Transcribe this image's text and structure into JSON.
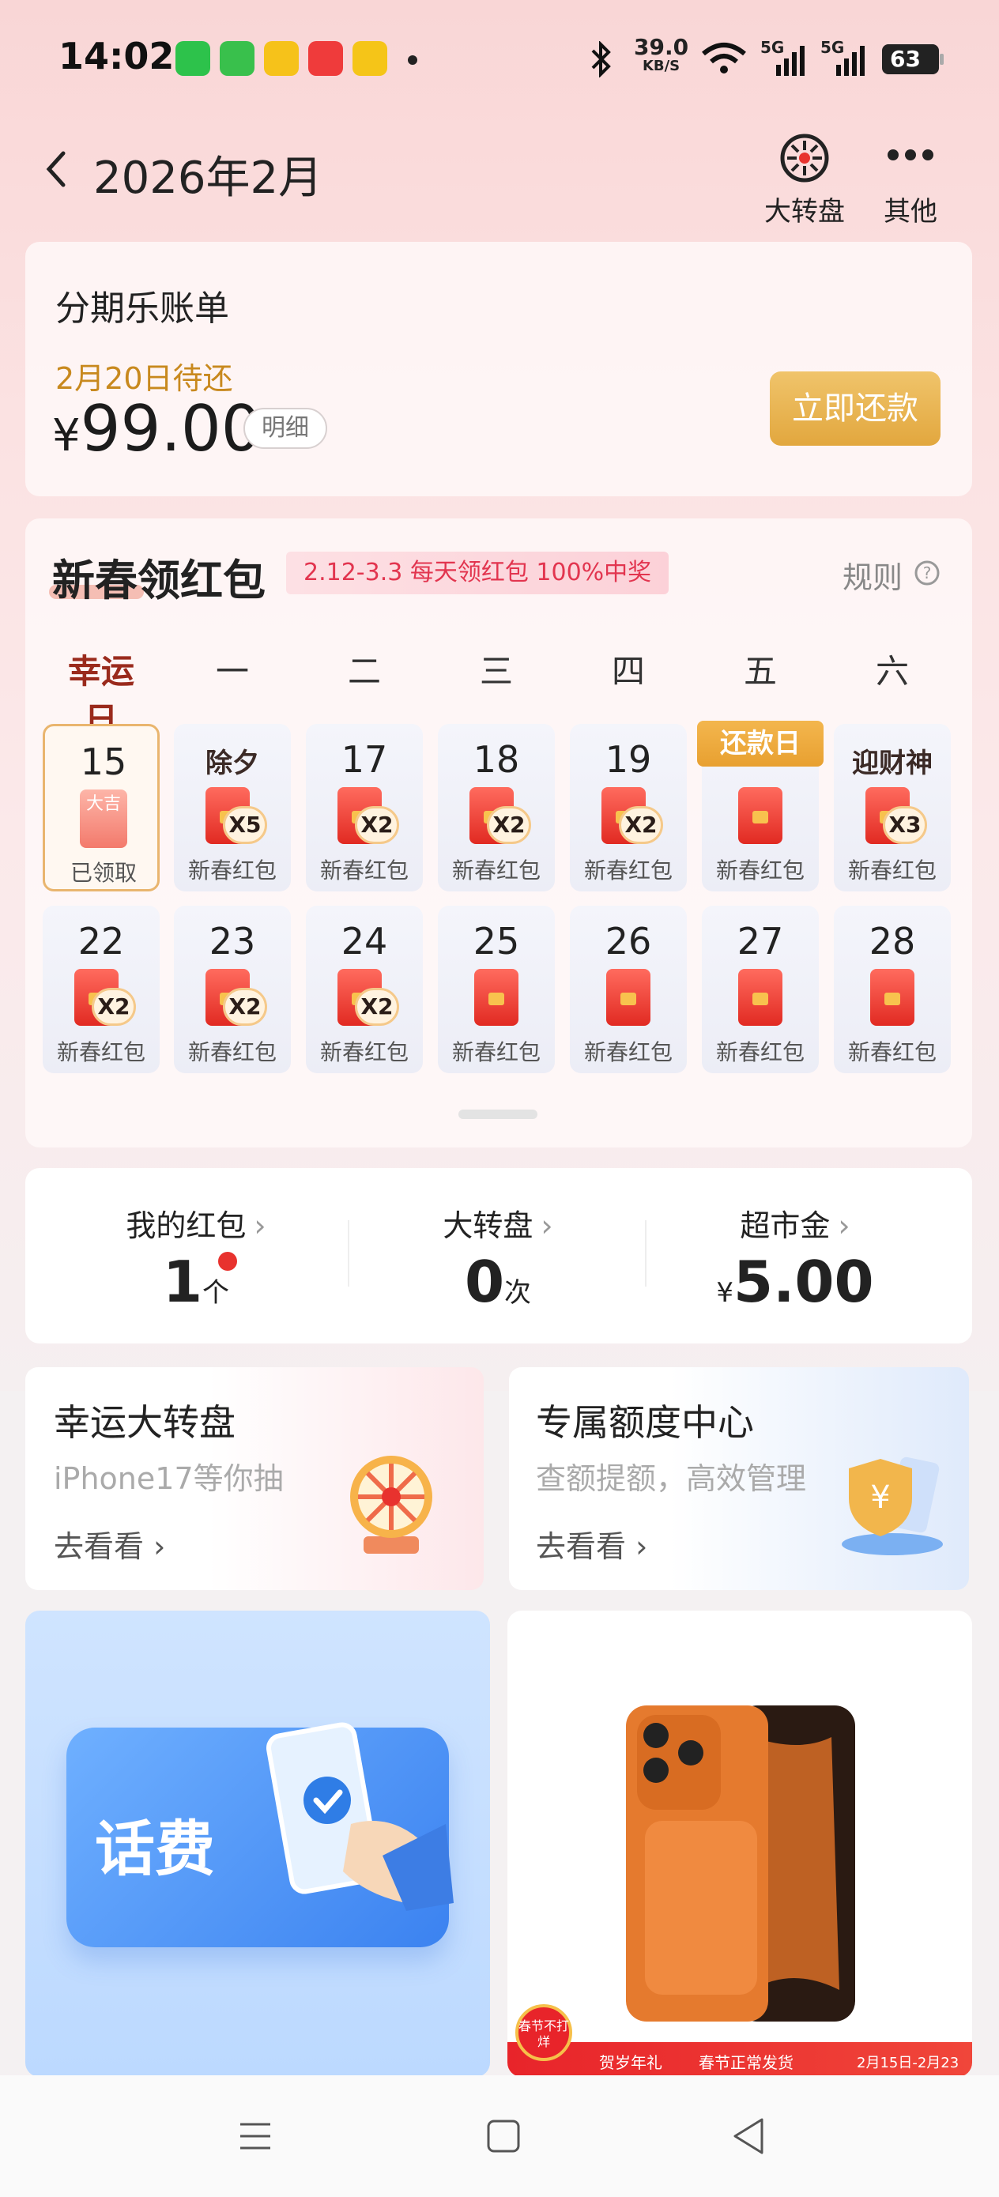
{
  "status_bar": {
    "time": "14:02",
    "network_speed": "39.0",
    "network_speed_unit": "KB/S",
    "signal_1": "5G",
    "signal_2": "5G",
    "battery": "63"
  },
  "nav": {
    "title": "2026年2月",
    "wheel_label": "大转盘",
    "more_label": "其他"
  },
  "bill": {
    "title": "分期乐账单",
    "due_date": "2月20日待还",
    "currency": "¥",
    "amount": "99.00",
    "detail_label": "明细",
    "pay_label": "立即还款"
  },
  "new_year": {
    "title": "新春领红包",
    "promo": "2.12-3.3  每天领红包 100%中奖",
    "rules_label": "规则",
    "weekdays": [
      "幸运日",
      "一",
      "二",
      "三",
      "四",
      "五",
      "六"
    ],
    "days": [
      {
        "label": "15",
        "caption": "已领取",
        "envelope_text": "大吉"
      },
      {
        "label": "除夕",
        "caption": "新春红包",
        "multiplier": "X5"
      },
      {
        "label": "17",
        "caption": "新春红包",
        "multiplier": "X2"
      },
      {
        "label": "18",
        "caption": "新春红包",
        "multiplier": "X2"
      },
      {
        "label": "19",
        "caption": "新春红包",
        "multiplier": "X2"
      },
      {
        "label": "还款日",
        "caption": "新春红包",
        "multiplier": ""
      },
      {
        "label": "迎财神",
        "caption": "新春红包",
        "multiplier": "X3"
      },
      {
        "label": "22",
        "caption": "新春红包",
        "multiplier": "X2"
      },
      {
        "label": "23",
        "caption": "新春红包",
        "multiplier": "X2"
      },
      {
        "label": "24",
        "caption": "新春红包",
        "multiplier": "X2"
      },
      {
        "label": "25",
        "caption": "新春红包",
        "multiplier": ""
      },
      {
        "label": "26",
        "caption": "新春红包",
        "multiplier": ""
      },
      {
        "label": "27",
        "caption": "新春红包",
        "multiplier": ""
      },
      {
        "label": "28",
        "caption": "新春红包",
        "multiplier": ""
      }
    ]
  },
  "stats": [
    {
      "label": "我的红包",
      "value": "1",
      "unit": "个",
      "prefix": ""
    },
    {
      "label": "大转盘",
      "value": "0",
      "unit": "次",
      "prefix": ""
    },
    {
      "label": "超市金",
      "value": "5.00",
      "unit": "",
      "prefix": "¥"
    }
  ],
  "features": [
    {
      "title": "幸运大转盘",
      "subtitle": "iPhone17等你抽",
      "link": "去看看"
    },
    {
      "title": "专属额度中心",
      "subtitle": "查额提额，高效管理",
      "link": "去看看"
    }
  ],
  "banners": {
    "phone_bill_text": "话费",
    "badge_text": "春节不打烊",
    "strip_1": "贺岁年礼",
    "strip_2": "春节正常发货",
    "strip_3": "2月15日-2月23日"
  },
  "colors": {
    "accent_gold": "#e2a73e",
    "promo_red": "#e2354f",
    "envelope_red": "#e12a22"
  }
}
